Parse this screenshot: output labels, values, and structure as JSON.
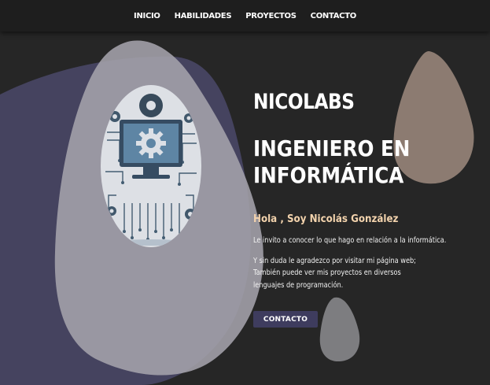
{
  "nav": {
    "items": [
      {
        "label": "INICIO"
      },
      {
        "label": "HABILIDADES"
      },
      {
        "label": "PROYECTOS"
      },
      {
        "label": "CONTACTO"
      }
    ]
  },
  "hero": {
    "brand": "NICOLABS",
    "headline_line1": "INGENIERO EN",
    "headline_line2": "INFORMÁTICA",
    "greeting": "Hola , Soy Nicolás González",
    "paragraph1": "Le invito a conocer lo que hago en relación a la informática.",
    "paragraph2": "Y sin duda le agradezco por visitar mi página web; También puede ver mis proyectos en diversos lenguajes de programación.",
    "cta_label": "CONTACTO",
    "illustration": "computer-gear-circuit-illustration"
  },
  "colors": {
    "background": "#262626",
    "navbar": "#1e1e1e",
    "accent_text": "#f3d3ad",
    "cta_background": "#3e3c5e",
    "blob_indigo": "#45435f",
    "blob_grey": "#9a99a1",
    "blob_tan": "#8c7b71",
    "blob_small_grey": "#7d7d80"
  }
}
